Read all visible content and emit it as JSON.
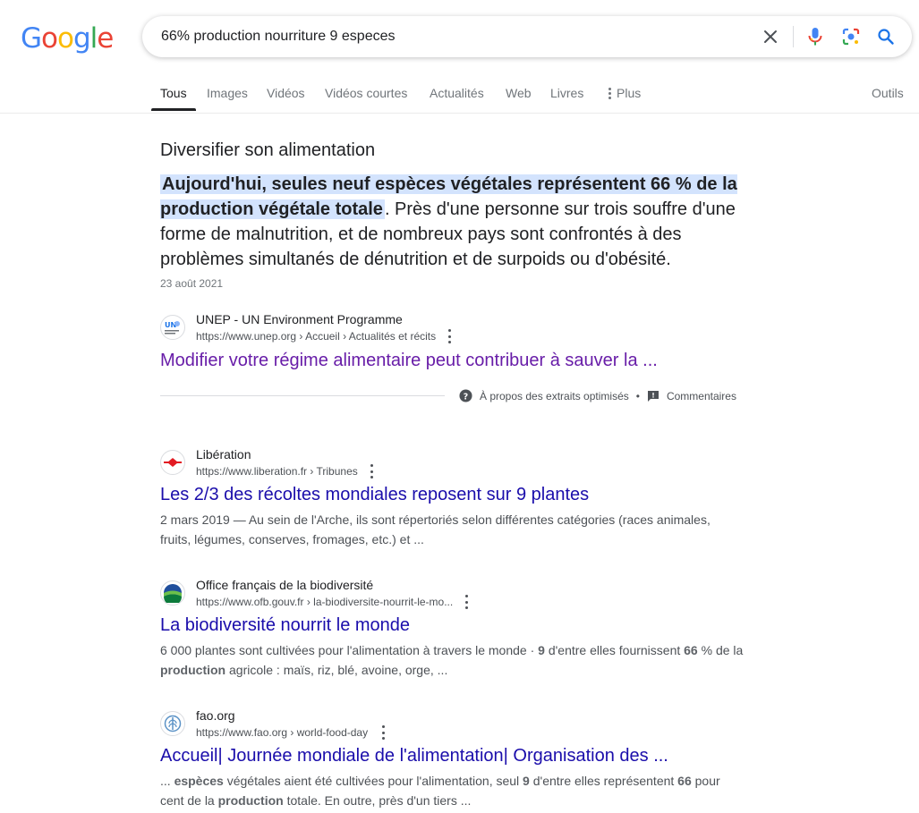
{
  "logo": {
    "letters": [
      "G",
      "o",
      "o",
      "g",
      "l",
      "e"
    ],
    "colors": [
      "#4285F4",
      "#EA4335",
      "#FBBC05",
      "#4285F4",
      "#34A853",
      "#EA4335"
    ]
  },
  "search": {
    "query": "66% production nourriture 9 especes",
    "icons": [
      "close-icon",
      "mic-icon",
      "lens-icon",
      "search-icon"
    ]
  },
  "tabs": {
    "items": [
      "Tous",
      "Images",
      "Vidéos",
      "Vidéos courtes",
      "Actualités",
      "Web",
      "Livres",
      "Plus"
    ],
    "tools": "Outils"
  },
  "featured": {
    "heading": "Diversifier son alimentation",
    "highlight": "Aujourd'hui, seules neuf espèces végétales représentent 66 % de la production végétale totale",
    "rest": ". Près d'une personne sur trois souffre d'une forme de malnutrition, et de nombreux pays sont confrontés à des problèmes simultanés de dénutrition et de surpoids ou d'obésité.",
    "date": "23 août 2021",
    "source": "UNEP - UN Environment Programme",
    "url": "https://www.unep.org › Accueil › Actualités et récits",
    "title": "Modifier votre régime alimentaire peut contribuer à sauver la ...",
    "about": "À propos des extraits optimisés",
    "bullet": "•",
    "feedback": "Commentaires"
  },
  "results": [
    {
      "source": "Libération",
      "url": "https://www.liberation.fr › Tribunes",
      "title": "Les 2/3 des récoltes mondiales reposent sur 9 plantes",
      "snippet_1": "2 mars 2019 — Au sein de l'Arche, ils sont répertoriés selon différentes catégories (races animales,",
      "snippet_2": "fruits, légumes, conserves, fromages, etc.) et ..."
    },
    {
      "source": "Office français de la biodiversité",
      "url": "https://www.ofb.gouv.fr › la-biodiversite-nourrit-le-mo...",
      "title": "La biodiversité nourrit le monde",
      "s1a": "6 000 plantes sont cultivées pour l'alimentation à travers le monde · ",
      "s1b": "9",
      "s1c": " d'entre elles fournissent ",
      "s1d": "66",
      "s1e": " % de la",
      "s2a": "production",
      "s2b": " agricole : maïs, riz, blé, avoine, orge, ..."
    },
    {
      "source": "fao.org",
      "url": "https://www.fao.org › world-food-day",
      "title": "Accueil| Journée mondiale de l'alimentation| Organisation des ...",
      "s1a": "... ",
      "s1b": "espèces",
      "s1c": " végétales aient été cultivées pour l'alimentation, seul ",
      "s1d": "9",
      "s1e": " d'entre elles représentent ",
      "s1f": "66",
      "s1g": " pour",
      "s2a": "cent de la ",
      "s2b": "production",
      "s2c": " totale. En outre, près d'un tiers ..."
    }
  ]
}
